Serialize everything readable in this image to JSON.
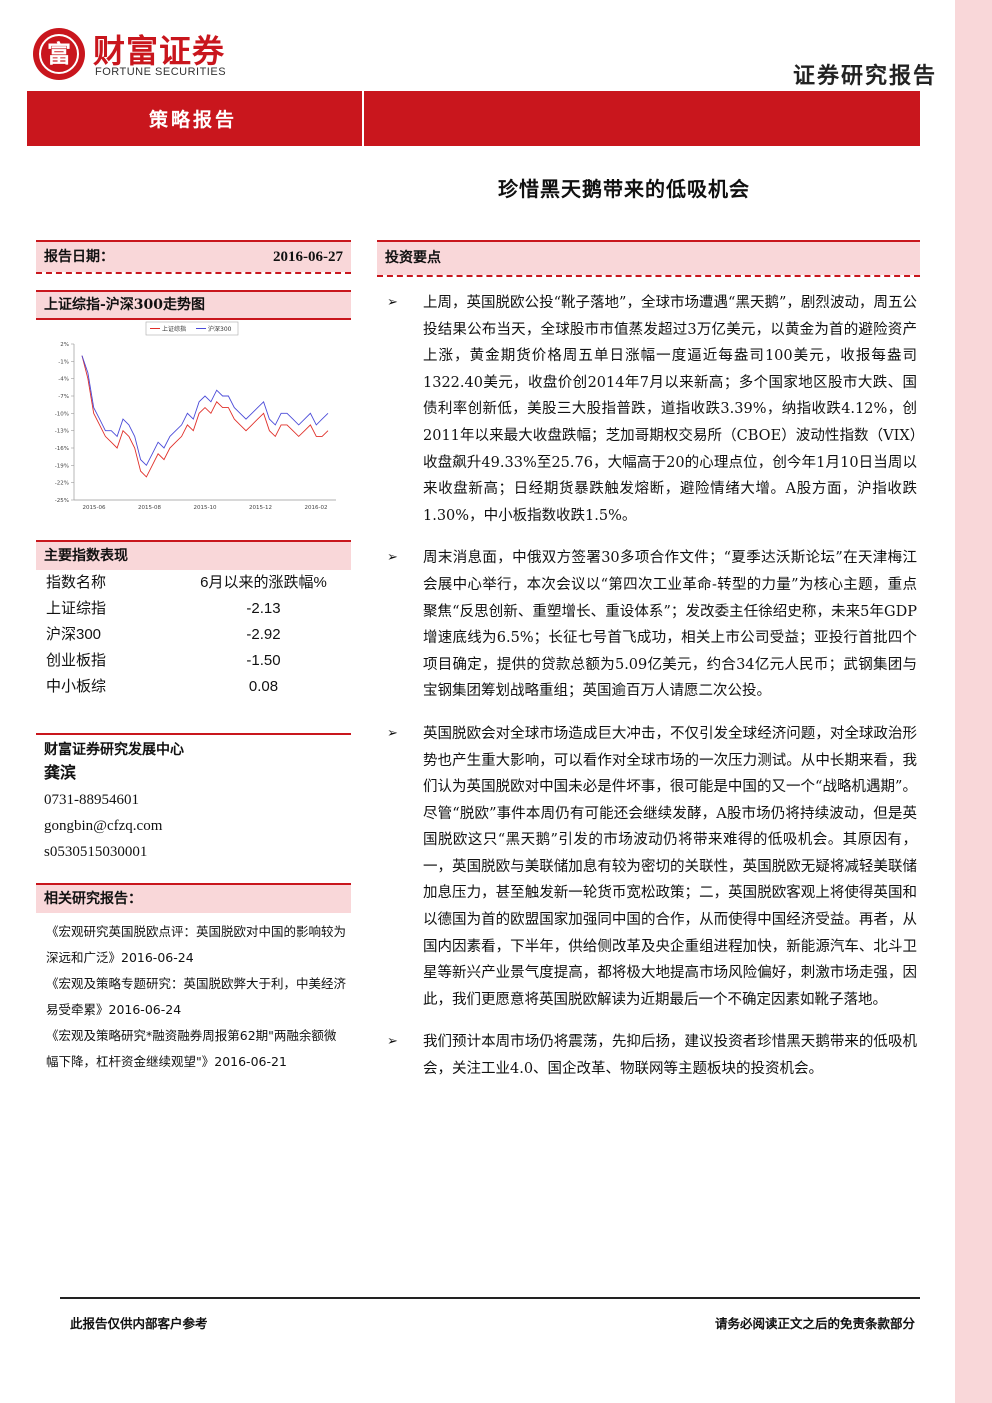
{
  "header": {
    "logo_glyph": "富",
    "brand_cn": "财富证券",
    "brand_en": "FORTUNE SECURITIES",
    "report_type": "证券研究报告",
    "section_label": "策略报告",
    "title": "珍惜黑天鹅带来的低吸机会",
    "brand_color": "#c9161d",
    "accent_pink": "#f9d7d9"
  },
  "report_date": {
    "label": "报告日期：",
    "value": "2016-06-27"
  },
  "chart_section": {
    "title": "上证综指-沪深300走势图"
  },
  "chart_data": {
    "type": "line",
    "title": "",
    "legend": [
      "上证综指",
      "沪深300"
    ],
    "legend_position": "top-center",
    "ylim": [
      -23,
      2
    ],
    "yticks": [
      "2%",
      "-1%",
      "-4%",
      "-7%",
      "-10%",
      "-13%",
      "-16%",
      "-19%",
      "-22%",
      "-25%"
    ],
    "ytick_values": [
      2,
      -1,
      -4,
      -7,
      -10,
      -13,
      -16,
      -19,
      -22,
      -25
    ],
    "xticks": [
      "2015-06",
      "2015-08",
      "2015-10",
      "2015-12",
      "2016-02"
    ],
    "series": [
      {
        "name": "上证综指",
        "color": "#e0302a",
        "values": [
          0,
          -4,
          -10,
          -12,
          -14,
          -15,
          -16,
          -13,
          -14,
          -16,
          -20,
          -21,
          -19,
          -17,
          -18,
          -16,
          -15,
          -14,
          -12,
          -13,
          -10,
          -9,
          -10,
          -8,
          -9,
          -9,
          -11,
          -12,
          -13,
          -12,
          -11,
          -10,
          -13,
          -14,
          -12,
          -12,
          -13,
          -14,
          -13,
          -12,
          -14,
          -14,
          -13
        ]
      },
      {
        "name": "沪深300",
        "color": "#4b4bd8",
        "values": [
          0,
          -3,
          -9,
          -11,
          -13,
          -13,
          -14,
          -11,
          -12,
          -14,
          -18,
          -19,
          -17,
          -15,
          -16,
          -14,
          -13,
          -12,
          -10,
          -11,
          -8,
          -7,
          -8,
          -6,
          -7,
          -7,
          -9,
          -10,
          -11,
          -10,
          -9,
          -8,
          -11,
          -12,
          -10,
          -10,
          -11,
          -12,
          -11,
          -10,
          -12,
          -11,
          -10
        ]
      }
    ]
  },
  "index_table": {
    "title": "主要指数表现",
    "headers": [
      "指数名称",
      "6月以来的涨跌幅%"
    ],
    "rows": [
      {
        "name": "上证综指",
        "value": "-2.13"
      },
      {
        "name": "沪深300",
        "value": "-2.92"
      },
      {
        "name": "创业板指",
        "value": "-1.50"
      },
      {
        "name": "中小板综",
        "value": "0.08"
      }
    ]
  },
  "contact": {
    "title": "财富证券研究发展中心",
    "name": "龚滨",
    "phone": "0731-88954601",
    "email": "gongbin@cfzq.com",
    "license": "s0530515030001"
  },
  "related": {
    "title": "相关研究报告：",
    "items": [
      "《宏观研究英国脱欧点评：英国脱欧对中国的影响较为深远和广泛》2016-06-24",
      "《宏观及策略专题研究：英国脱欧弊大于利，中美经济易受牵累》2016-06-24",
      "《宏观及策略研究*融资融券周报第62期\"两融余额微幅下降，杠杆资金继续观望\"》2016-06-21"
    ]
  },
  "investment": {
    "title": "投资要点",
    "arrow": "➢",
    "bullets": [
      "上周，英国脱欧公投“靴子落地”，全球市场遭遇“黑天鹅”，剧烈波动，周五公投结果公布当天，全球股市市值蒸发超过3万亿美元，以黄金为首的避险资产上涨，黄金期货价格周五单日涨幅一度逼近每盎司100美元，收报每盎司1322.40美元，收盘价创2014年7月以来新高；多个国家地区股市大跌、国债利率创新低，美股三大股指普跌，道指收跌3.39%，纳指收跌4.12%，创2011年以来最大收盘跌幅；芝加哥期权交易所（CBOE）波动性指数（VIX）收盘飙升49.33%至25.76，大幅高于20的心理点位，创今年1月10日当周以来收盘新高；日经期货暴跌触发熔断，避险情绪大增。A股方面，沪指收跌1.30%，中小板指数收跌1.5%。",
      "周末消息面，中俄双方签署30多项合作文件；“夏季达沃斯论坛”在天津梅江会展中心举行，本次会议以“第四次工业革命-转型的力量”为核心主题，重点聚焦“反思创新、重塑增长、重设体系”；发改委主任徐绍史称，未来5年GDP增速底线为6.5%；长征七号首飞成功，相关上市公司受益；亚投行首批四个项目确定，提供的贷款总额为5.09亿美元，约合34亿元人民币；武钢集团与宝钢集团筹划战略重组；英国逾百万人请愿二次公投。",
      "英国脱欧会对全球市场造成巨大冲击，不仅引发全球经济问题，对全球政治形势也产生重大影响，可以看作对全球市场的一次压力测试。从中长期来看，我们认为英国脱欧对中国未必是件坏事，很可能是中国的又一个“战略机遇期”。尽管“脱欧”事件本周仍有可能还会继续发酵，A股市场仍将持续波动，但是英国脱欧这只“黑天鹅”引发的市场波动仍将带来难得的低吸机会。其原因有，一，英国脱欧与美联储加息有较为密切的关联性，英国脱欧无疑将减轻美联储加息压力，甚至触发新一轮货币宽松政策；二，英国脱欧客观上将使得英国和以德国为首的欧盟国家加强同中国的合作，从而使得中国经济受益。再者，从国内因素看，下半年，供给侧改革及央企重组进程加快，新能源汽车、北斗卫星等新兴产业景气度提高，都将极大地提高市场风险偏好，刺激市场走强，因此，我们更愿意将英国脱欧解读为近期最后一个不确定因素如靴子落地。",
      "我们预计本周市场仍将震荡，先抑后扬，建议投资者珍惜黑天鹅带来的低吸机会，关注工业4.0、国企改革、物联网等主题板块的投资机会。"
    ]
  },
  "footer": {
    "left": "此报告仅供内部客户参考",
    "right": "请务必阅读正文之后的免责条款部分"
  }
}
